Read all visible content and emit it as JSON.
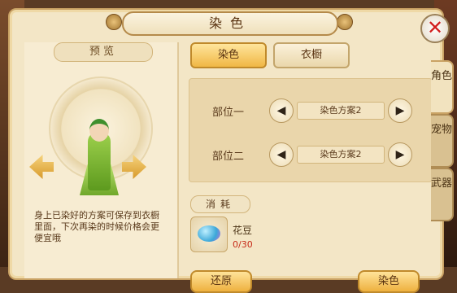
{
  "window": {
    "title": "染色",
    "close_symbol": "✕"
  },
  "preview": {
    "label": "预览",
    "tip": "身上已染好的方案可保存到衣橱里面，下次再染的时候价格会更便宜哦"
  },
  "tabs": [
    {
      "label": "染色",
      "active": true
    },
    {
      "label": "衣橱",
      "active": false
    }
  ],
  "parts": [
    {
      "label": "部位一",
      "scheme": "染色方案2"
    },
    {
      "label": "部位二",
      "scheme": "染色方案2"
    }
  ],
  "consume": {
    "label": "消耗",
    "item_name": "花豆",
    "item_count": "0/30"
  },
  "side_tabs": [
    {
      "label": "角色",
      "active": true
    },
    {
      "label": "宠物",
      "active": false
    },
    {
      "label": "武器",
      "active": false
    }
  ],
  "bottom_buttons": [
    {
      "label": "还原"
    },
    {
      "label": "染色"
    }
  ],
  "arrows": {
    "prev": "◀",
    "next": "▶"
  }
}
